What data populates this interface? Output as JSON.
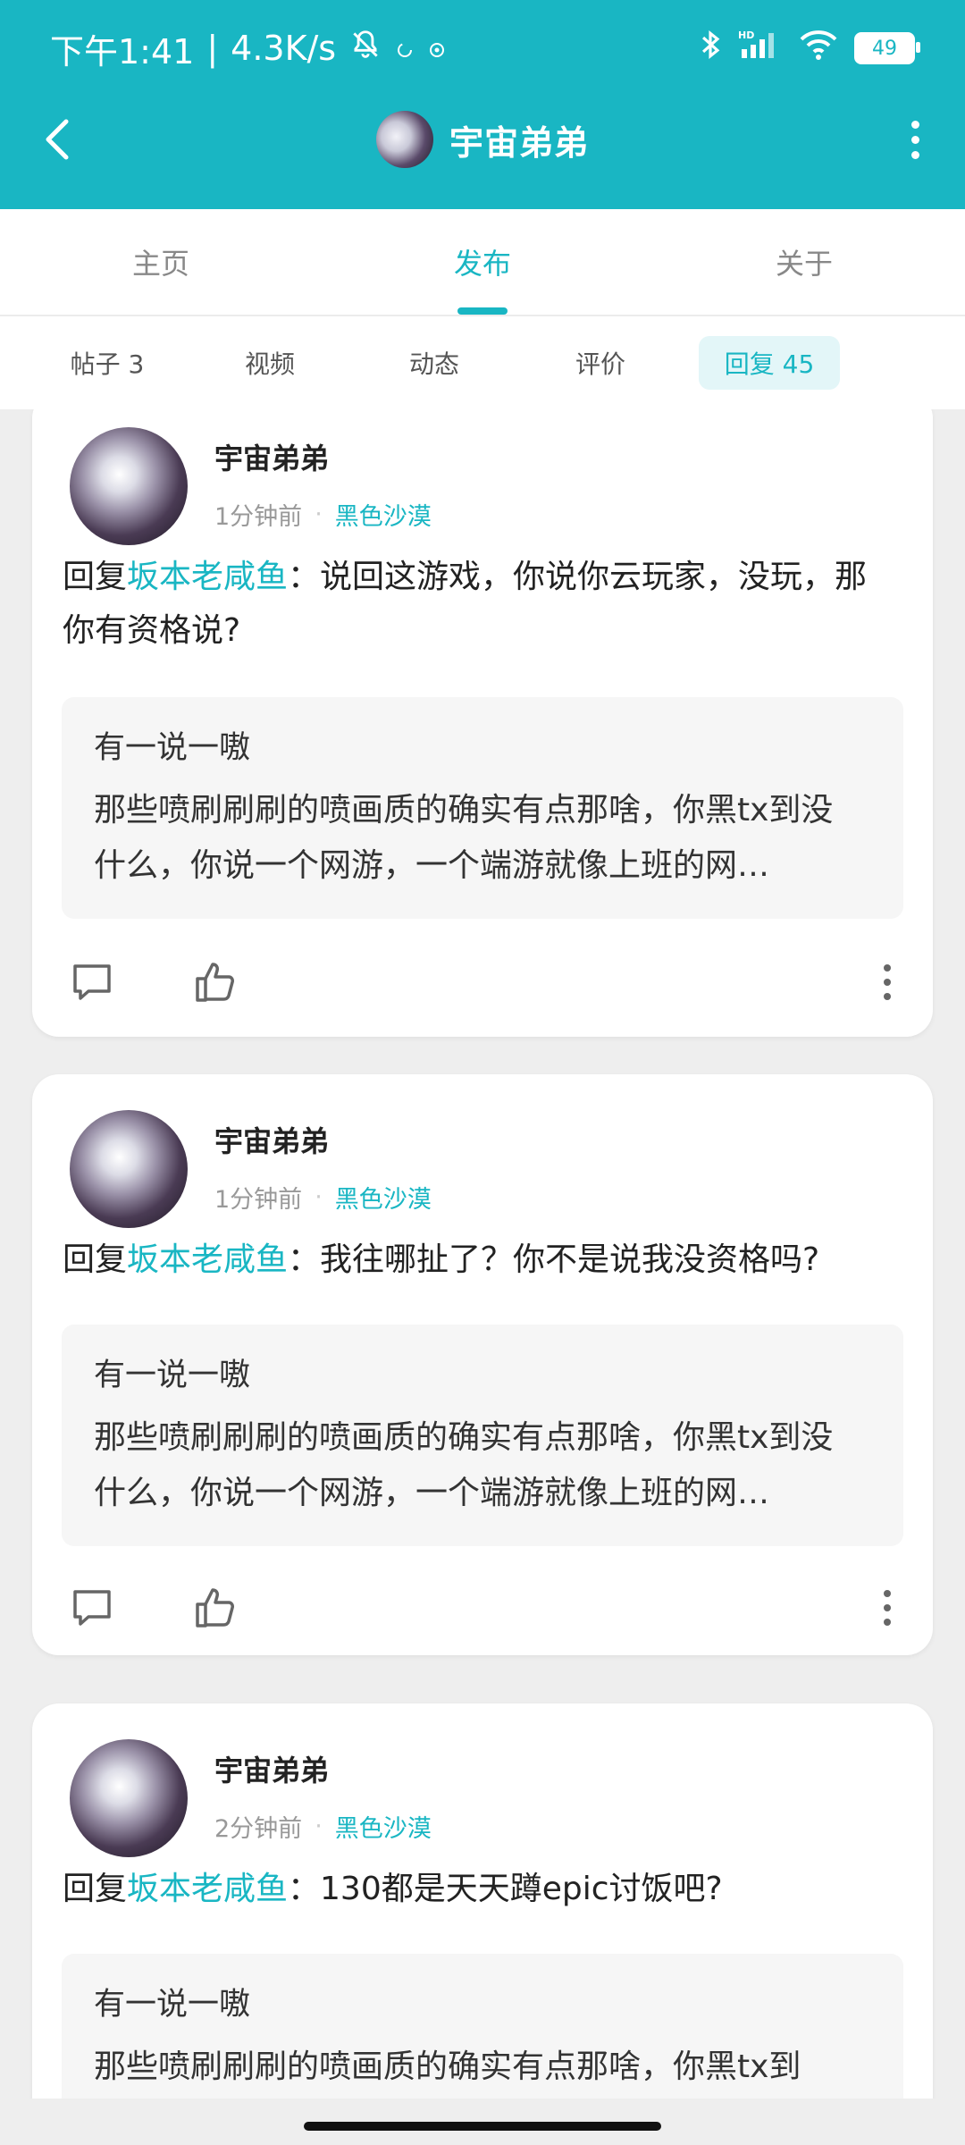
{
  "status_bar": {
    "time": "下午1:41",
    "net_speed": "4.3K/s",
    "separator": "|",
    "battery": "49"
  },
  "header": {
    "title": "宇宙弟弟",
    "back_icon": "back-arrow-icon",
    "more_icon": "more-vertical-icon"
  },
  "tabs": [
    {
      "label": "主页"
    },
    {
      "label": "发布"
    },
    {
      "label": "关于"
    }
  ],
  "subtabs": [
    {
      "label": "帖子 3"
    },
    {
      "label": "视频"
    },
    {
      "label": "动态"
    },
    {
      "label": "评价"
    },
    {
      "label": "回复 45"
    }
  ],
  "colors": {
    "accent": "#19b6c3",
    "background": "#eeeeee"
  },
  "posts": [
    {
      "username": "宇宙弟弟",
      "time": "1分钟前",
      "dot": "·",
      "game": "黑色沙漠",
      "reply_prefix": "回复",
      "reply_target": "坂本老咸鱼",
      "reply_text": "：说回这游戏，你说你云玩家，没玩，那你有资格说?",
      "quote_author": "有一说一嗷",
      "quote_text": "那些喷刷刷刷的喷画质的确实有点那啥，你黑tx到没什么，你说一个网游，一个端游就像上班的网…"
    },
    {
      "username": "宇宙弟弟",
      "time": "1分钟前",
      "dot": "·",
      "game": "黑色沙漠",
      "reply_prefix": "回复",
      "reply_target": "坂本老咸鱼",
      "reply_text": "：我往哪扯了？你不是说我没资格吗?",
      "quote_author": "有一说一嗷",
      "quote_text": "那些喷刷刷刷的喷画质的确实有点那啥，你黑tx到没什么，你说一个网游，一个端游就像上班的网…"
    },
    {
      "username": "宇宙弟弟",
      "time": "2分钟前",
      "dot": "·",
      "game": "黑色沙漠",
      "reply_prefix": "回复",
      "reply_target": "坂本老咸鱼",
      "reply_text": "：130都是天天蹲epic讨饭吧?",
      "quote_author": "有一说一嗷",
      "quote_text": "那些喷刷刷刷的喷画质的确实有点那啥，你黑tx到"
    }
  ]
}
